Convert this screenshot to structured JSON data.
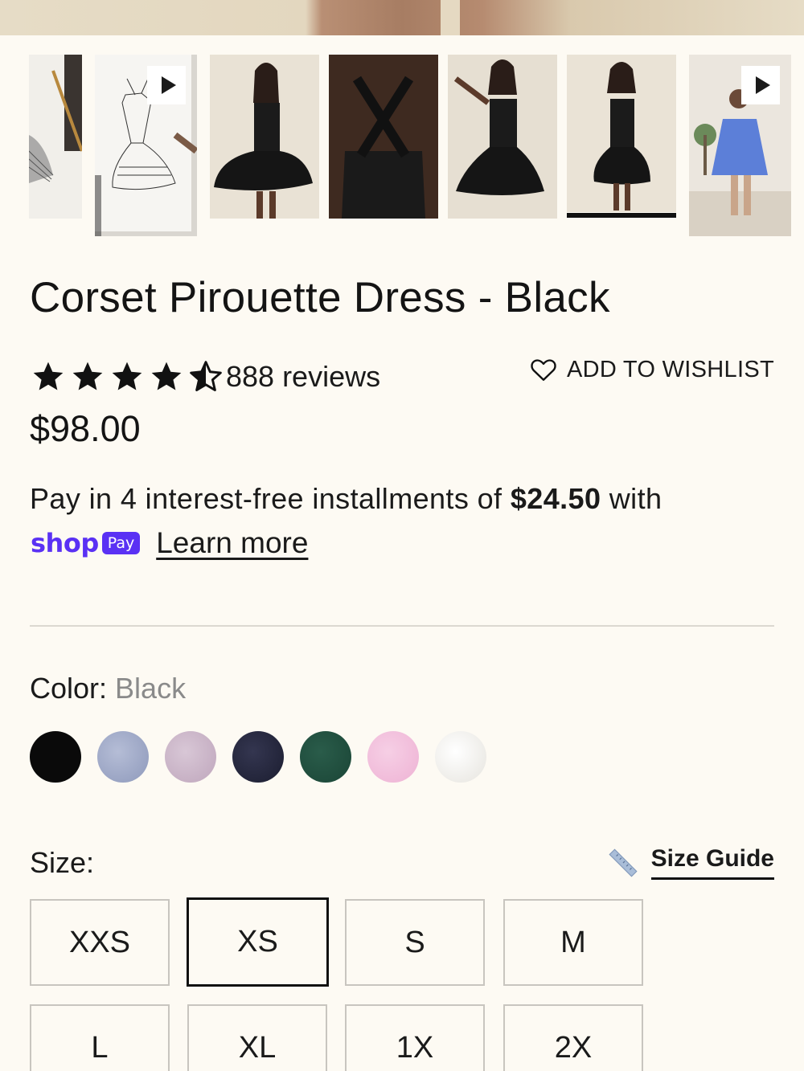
{
  "gallery": {
    "thumbnails": [
      {
        "kind": "sketch-partial",
        "video": false
      },
      {
        "kind": "sketch-video",
        "video": true
      },
      {
        "kind": "photo-front",
        "video": false
      },
      {
        "kind": "photo-back",
        "video": false
      },
      {
        "kind": "photo-pose",
        "video": false
      },
      {
        "kind": "photo-pose-selected",
        "video": false,
        "active": true
      },
      {
        "kind": "video-blue-dress",
        "video": true
      }
    ],
    "play_icon": "play-icon"
  },
  "product": {
    "title": "Corset Pirouette Dress - Black",
    "rating": 4.5,
    "reviews_text": "888 reviews",
    "price": "$98.00"
  },
  "wishlist": {
    "icon": "heart-outline-icon",
    "label": "ADD TO WISHLIST"
  },
  "installments": {
    "prefix": "Pay in 4 interest-free installments of ",
    "amount": "$24.50",
    "suffix": " with",
    "shop_word": "shop",
    "pay_badge": "Pay",
    "learn_more": "Learn more",
    "brand_color": "#5a31f4"
  },
  "color": {
    "label": "Color: ",
    "selected": "Black",
    "swatches": [
      {
        "name": "black",
        "hex": "#0a0a0a"
      },
      {
        "name": "light-blue",
        "hex": "#9aa4c4"
      },
      {
        "name": "lilac",
        "hex": "#c9b3c6"
      },
      {
        "name": "navy",
        "hex": "#23253a"
      },
      {
        "name": "green",
        "hex": "#1f4d3d"
      },
      {
        "name": "pink",
        "hex": "#f0bddb"
      },
      {
        "name": "white",
        "hex": "#f3f2ee"
      }
    ]
  },
  "size": {
    "label": "Size:",
    "guide_label": "Size Guide",
    "guide_icon": "ruler-icon",
    "options": [
      "XXS",
      "XS",
      "S",
      "M",
      "L",
      "XL",
      "1X",
      "2X"
    ],
    "selected": "XS"
  }
}
